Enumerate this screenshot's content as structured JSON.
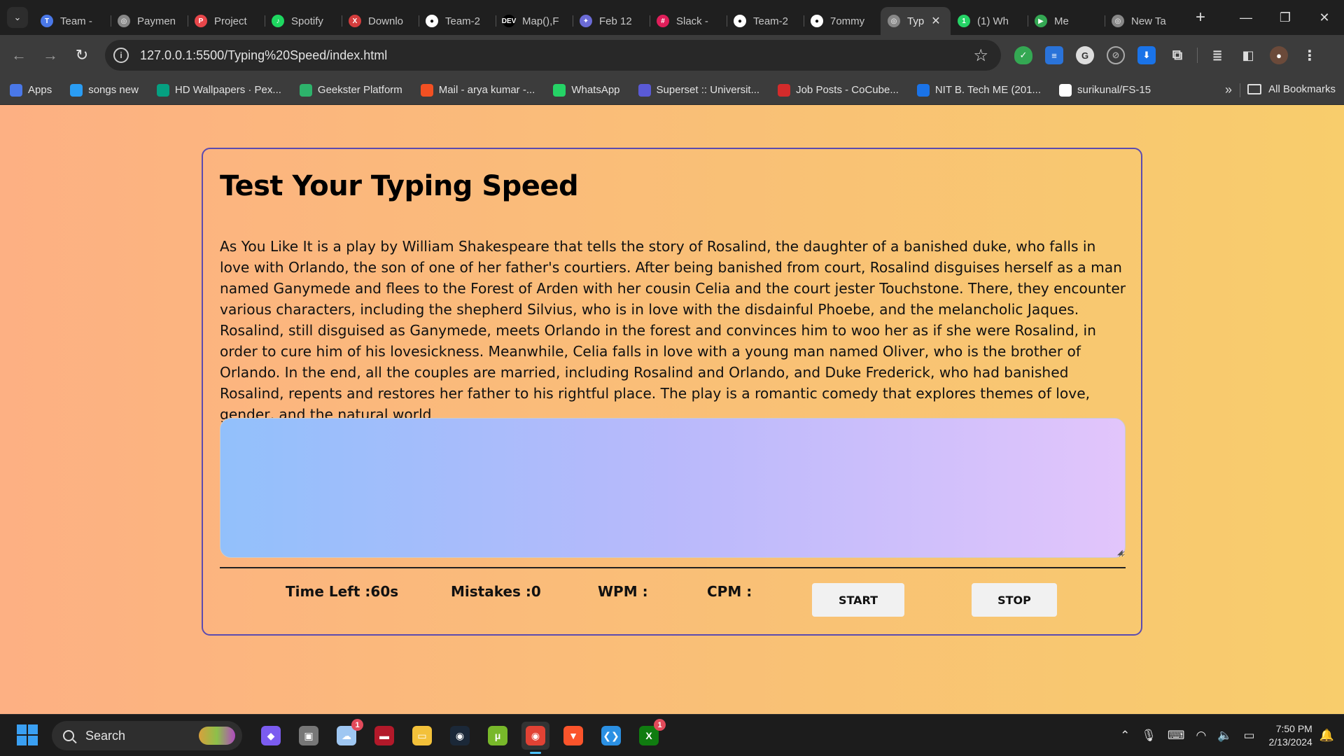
{
  "browser": {
    "tabs": [
      {
        "title": "Team -",
        "color": "#4a78e8",
        "glyph": "T"
      },
      {
        "title": "Paymen",
        "color": "#888888",
        "glyph": "◎"
      },
      {
        "title": "Project",
        "color": "#e8464a",
        "glyph": "P"
      },
      {
        "title": "Spotify",
        "color": "#1ed760",
        "glyph": "♪"
      },
      {
        "title": "Downlo",
        "color": "#d43d3d",
        "glyph": "X"
      },
      {
        "title": "Team-2",
        "color": "#ffffff",
        "glyph": "●"
      },
      {
        "title": "Map(),F",
        "color": "#000000",
        "glyph": "DEV"
      },
      {
        "title": "Feb 12",
        "color": "#6b6bd6",
        "glyph": "✦"
      },
      {
        "title": "Slack -",
        "color": "#e01e5a",
        "glyph": "#"
      },
      {
        "title": "Team-2",
        "color": "#ffffff",
        "glyph": "●"
      },
      {
        "title": "7ommy",
        "color": "#ffffff",
        "glyph": "●"
      },
      {
        "title": "Typ",
        "color": "#888888",
        "glyph": "◎"
      },
      {
        "title": "(1) Wh",
        "color": "#25d366",
        "glyph": "1"
      },
      {
        "title": "Me",
        "color": "#34a853",
        "glyph": "▶"
      },
      {
        "title": "New Ta",
        "color": "#888888",
        "glyph": "◎"
      }
    ],
    "active_tab_index": 11,
    "url": "127.0.0.1:5500/Typing%20Speed/index.html",
    "bookmarks": [
      {
        "label": "Apps",
        "color": "#4a78e8"
      },
      {
        "label": "songs new",
        "color": "#2a9df4"
      },
      {
        "label": "HD Wallpapers · Pex...",
        "color": "#05a081"
      },
      {
        "label": "Geekster Platform",
        "color": "#2db36b"
      },
      {
        "label": "Mail - arya kumar -...",
        "color": "#f25022"
      },
      {
        "label": "WhatsApp",
        "color": "#25d366"
      },
      {
        "label": "Superset :: Universit...",
        "color": "#5a5ad6"
      },
      {
        "label": "Job Posts - CoCube...",
        "color": "#d42b2b"
      },
      {
        "label": "NIT B. Tech ME (201...",
        "color": "#1a73e8"
      },
      {
        "label": "surikunal/FS-15",
        "color": "#ffffff"
      }
    ],
    "all_bookmarks_label": "All Bookmarks"
  },
  "page": {
    "title": "Test Your Typing Speed",
    "paragraph": "As You Like It is a play by William Shakespeare that tells the story of Rosalind, the daughter of a banished duke, who falls in love with Orlando, the son of one of her father's courtiers. After being banished from court, Rosalind disguises herself as a man named Ganymede and flees to the Forest of Arden with her cousin Celia and the court jester Touchstone. There, they encounter various characters, including the shepherd Silvius, who is in love with the disdainful Phoebe, and the melancholic Jaques. Rosalind, still disguised as Ganymede, meets Orlando in the forest and convinces him to woo her as if she were Rosalind, in order to cure him of his lovesickness. Meanwhile, Celia falls in love with a young man named Oliver, who is the brother of Orlando. In the end, all the couples are married, including Rosalind and Orlando, and Duke Frederick, who had banished Rosalind, repents and restores her father to his rightful place. The play is a romantic comedy that explores themes of love, gender, and the natural world",
    "input_value": "",
    "stats": {
      "time_left": "Time Left :60s",
      "mistakes": "Mistakes :0",
      "wpm": "WPM :",
      "cpm": "CPM :"
    },
    "buttons": {
      "start": "START",
      "stop": "STOP"
    }
  },
  "taskbar": {
    "search_label": "Search",
    "apps": [
      {
        "name": "copilot",
        "color": "#7b5cf0",
        "glyph": "◆"
      },
      {
        "name": "task-view",
        "color": "#777777",
        "glyph": "▣"
      },
      {
        "name": "weather",
        "color": "#9fc7f2",
        "glyph": "☁",
        "badge": "1"
      },
      {
        "name": "game-app",
        "color": "#b3192a",
        "glyph": "▬"
      },
      {
        "name": "file-explorer",
        "color": "#f3c13a",
        "glyph": "▭"
      },
      {
        "name": "steam",
        "color": "#1b2838",
        "glyph": "◉"
      },
      {
        "name": "utorrent",
        "color": "#78b82a",
        "glyph": "μ"
      },
      {
        "name": "chrome",
        "color": "#e24234",
        "glyph": "◉",
        "active": true
      },
      {
        "name": "brave",
        "color": "#fb542b",
        "glyph": "▼"
      },
      {
        "name": "vscode",
        "color": "#2b90e3",
        "glyph": "❮❯"
      },
      {
        "name": "xbox",
        "color": "#107c10",
        "glyph": "X",
        "badge": "1"
      }
    ],
    "time": "7:50 PM",
    "date": "2/13/2024"
  }
}
